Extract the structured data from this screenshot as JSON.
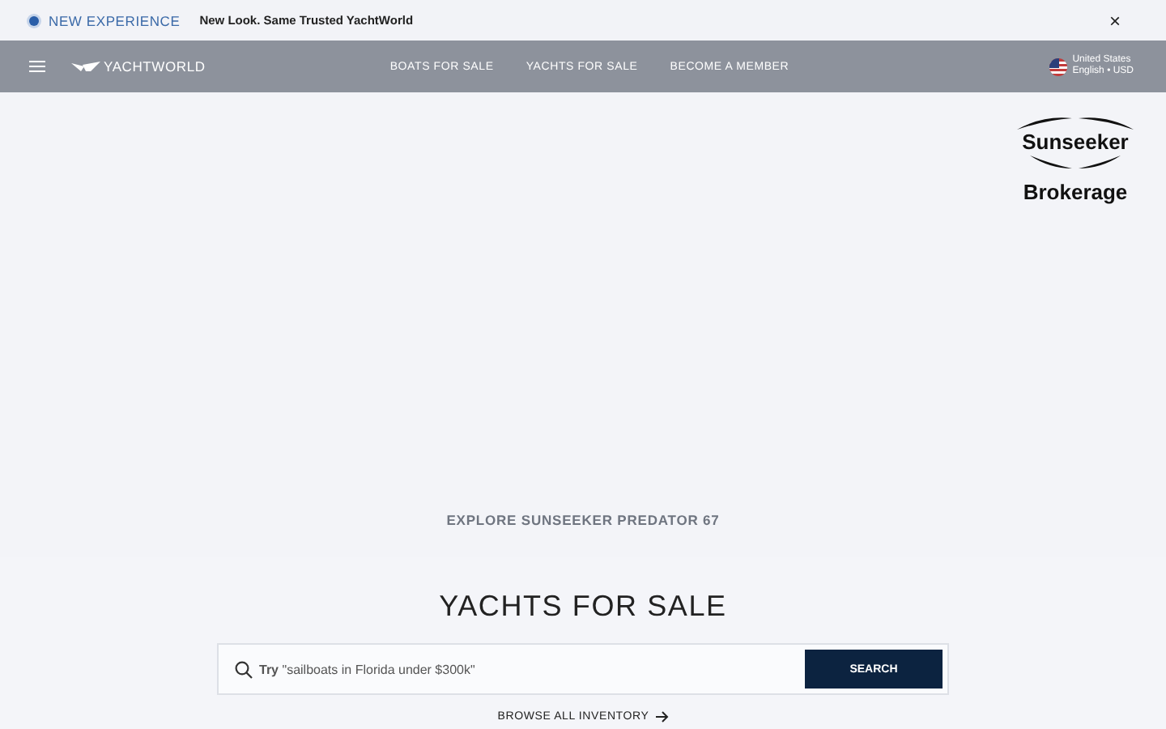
{
  "banner": {
    "badge": "NEW EXPERIENCE",
    "message": "New Look. Same Trusted YachtWorld",
    "close": "×"
  },
  "header": {
    "brand": "YACHTWORLD",
    "nav": [
      {
        "label": "BOATS FOR SALE"
      },
      {
        "label": "YACHTS FOR SALE"
      },
      {
        "label": "BECOME A MEMBER"
      }
    ],
    "locale": {
      "country": "United States",
      "language": "English • USD"
    }
  },
  "hero": {
    "caption": "EXPLORE SUNSEEKER PREDATOR 67",
    "logo": {
      "name": "Sunseeker",
      "subtitle": "Brokerage"
    }
  },
  "search": {
    "title": "YACHTS FOR SALE",
    "placeholder": "**Try** \"sailboats in Florida under $300k\"",
    "button": "SEARCH",
    "browse": "BROWSE ALL INVENTORY"
  }
}
